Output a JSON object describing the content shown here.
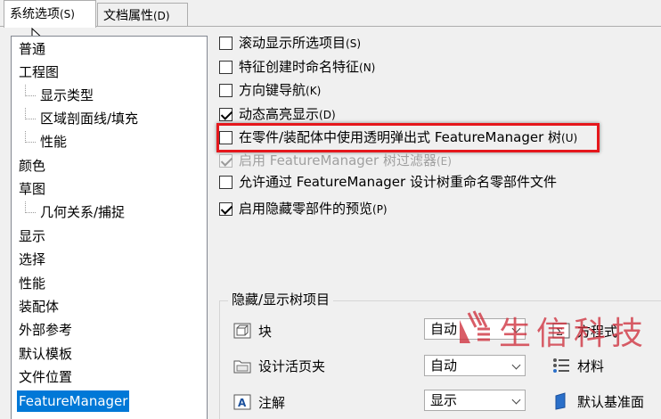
{
  "tabs": [
    {
      "label": "系统选项",
      "accel": "(S)"
    },
    {
      "label": "文档属性",
      "accel": "(D)"
    }
  ],
  "tree": [
    {
      "label": "普通"
    },
    {
      "label": "工程图"
    },
    {
      "label": "显示类型"
    },
    {
      "label": "区域剖面线/填充"
    },
    {
      "label": "性能"
    },
    {
      "label": "颜色"
    },
    {
      "label": "草图"
    },
    {
      "label": "几何关系/捕捉"
    },
    {
      "label": "显示"
    },
    {
      "label": "选择"
    },
    {
      "label": "性能"
    },
    {
      "label": "装配体"
    },
    {
      "label": "外部参考"
    },
    {
      "label": "默认模板"
    },
    {
      "label": "文件位置"
    },
    {
      "label": "FeatureManager"
    }
  ],
  "options": [
    {
      "label": "滚动显示所选项目",
      "accel": "(S)",
      "checked": false,
      "enabled": true
    },
    {
      "label": "特征创建时命名特征",
      "accel": "(N)",
      "checked": false,
      "enabled": true
    },
    {
      "label": "方向键导航",
      "accel": "(K)",
      "checked": false,
      "enabled": true
    },
    {
      "label": "动态高亮显示",
      "accel": "(D)",
      "checked": true,
      "enabled": true
    },
    {
      "label": "在零件/装配体中使用透明弹出式 FeatureManager 树",
      "accel": "(U)",
      "checked": false,
      "enabled": true
    },
    {
      "label": "启用 FeatureManager 树过滤器",
      "accel": "(E)",
      "checked": true,
      "enabled": false
    },
    {
      "label": "允许通过 FeatureManager 设计树重命名零部件文件",
      "accel": "",
      "checked": false,
      "enabled": true
    },
    {
      "label": "启用隐藏零部件的预览",
      "accel": "(P)",
      "checked": true,
      "enabled": true
    }
  ],
  "group": {
    "title": "隐藏/显示树项目",
    "rows": [
      {
        "label": "块",
        "value": "自动",
        "icon": "block-icon"
      },
      {
        "label": "设计活页夹",
        "value": "自动",
        "icon": "folder-icon"
      },
      {
        "label": "注解",
        "value": "显示",
        "icon": "annotation-icon"
      }
    ],
    "right_items": [
      {
        "label": "方程式",
        "icon": "equation-icon"
      },
      {
        "label": "材料",
        "icon": "material-icon"
      },
      {
        "label": "默认基准面",
        "icon": "plane-icon"
      }
    ]
  },
  "watermark": {
    "text": "生信科技"
  },
  "colors": {
    "highlight": "#e5171c",
    "selection": "#0078d7",
    "watermark": "#ce303c"
  }
}
